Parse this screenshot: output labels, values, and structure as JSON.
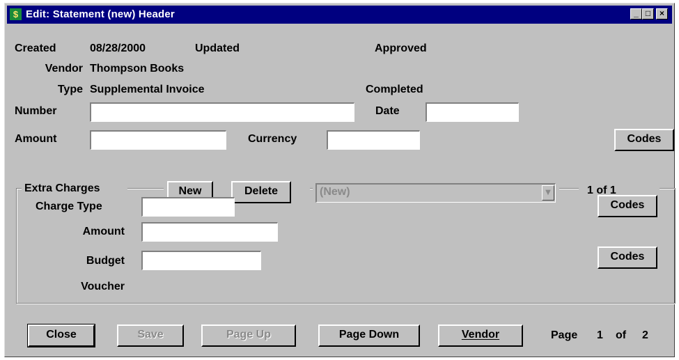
{
  "window": {
    "title": "Edit: Statement (new) Header",
    "icon": "dollar-app-icon",
    "minimize_glyph": "_",
    "restore_glyph": "□",
    "close_glyph": "×"
  },
  "header": {
    "created_label": "Created",
    "created_value": "08/28/2000",
    "updated_label": "Updated",
    "approved_label": "Approved",
    "vendor_label": "Vendor",
    "vendor_value": "Thompson Books",
    "type_label": "Type",
    "type_value": "Supplemental Invoice",
    "completed_label": "Completed",
    "number_label": "Number",
    "number_value": "",
    "date_label": "Date",
    "date_value": "",
    "amount_label": "Amount",
    "amount_value": "",
    "currency_label": "Currency",
    "currency_value": "",
    "codes_label": "Codes"
  },
  "extra_charges": {
    "group_label": "Extra Charges",
    "new_label": "New",
    "delete_label": "Delete",
    "selector_value": "(New)",
    "record_position": "1 of 1",
    "charge_type_label": "Charge Type",
    "charge_type_value": "",
    "charge_codes_label": "Codes",
    "amount_label": "Amount",
    "amount_value": "",
    "budget_label": "Budget",
    "budget_value": "",
    "budget_codes_label": "Codes",
    "voucher_label": "Voucher"
  },
  "footer": {
    "close_label": "Close",
    "save_label": "Save",
    "page_up_label": "Page Up",
    "page_down_label": "Page Down",
    "vendor_label": "Vendor",
    "page_word": "Page",
    "page_current": "1",
    "page_of": "of",
    "page_total": "2"
  }
}
